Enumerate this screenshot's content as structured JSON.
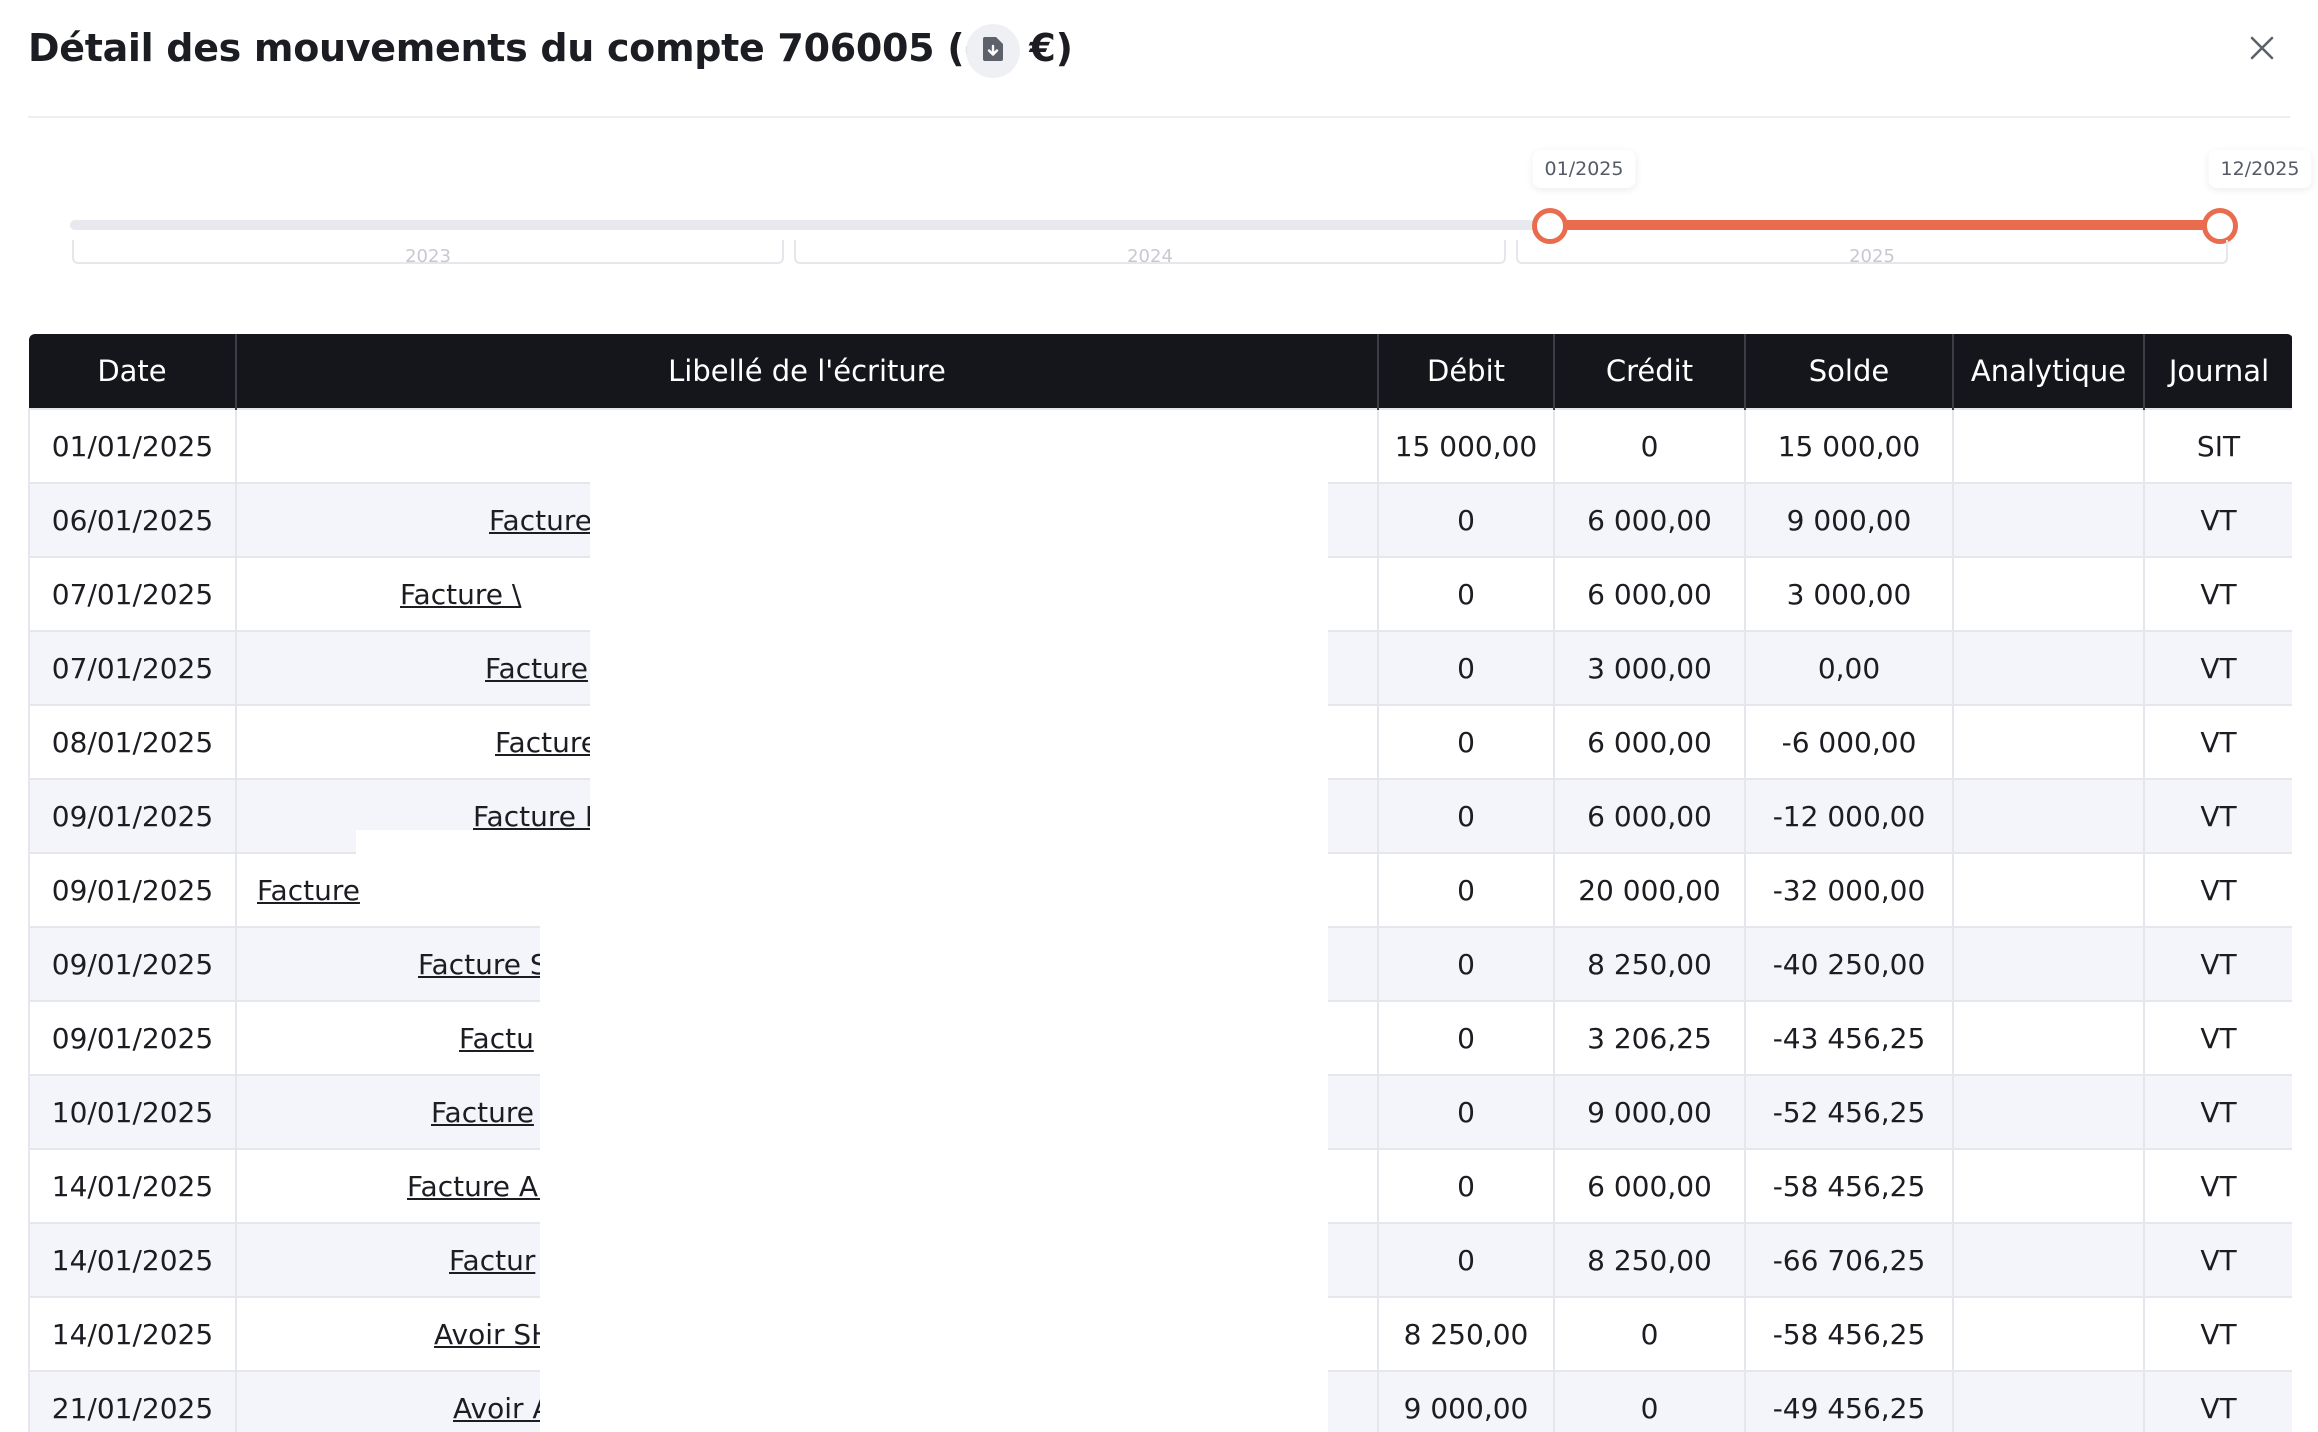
{
  "title": "Détail des mouvements du compte 706005 (en €)",
  "icons": {
    "export": "document-download-icon",
    "close": "close-icon"
  },
  "colors": {
    "accent": "#e96c4f",
    "header_bg": "#15161b"
  },
  "slider": {
    "start_label": "01/2025",
    "end_label": "12/2025",
    "years": [
      "2023",
      "2024",
      "2025"
    ]
  },
  "table": {
    "columns": [
      "Date",
      "Libellé de l'écriture",
      "Débit",
      "Crédit",
      "Solde",
      "Analytique",
      "Journal"
    ],
    "rows": [
      {
        "date": "01/01/2025",
        "libelle": "",
        "debit": "15 000,00",
        "credit": "0",
        "solde": "15 000,00",
        "analytique": "",
        "journal": "SIT"
      },
      {
        "date": "06/01/2025",
        "libelle": "Facture",
        "debit": "0",
        "credit": "6 000,00",
        "solde": "9 000,00",
        "analytique": "",
        "journal": "VT"
      },
      {
        "date": "07/01/2025",
        "libelle": "Facture \\",
        "debit": "0",
        "credit": "6 000,00",
        "solde": "3 000,00",
        "analytique": "",
        "journal": "VT"
      },
      {
        "date": "07/01/2025",
        "libelle": "Facture",
        "debit": "0",
        "credit": "3 000,00",
        "solde": "0,00",
        "analytique": "",
        "journal": "VT"
      },
      {
        "date": "08/01/2025",
        "libelle": "Facture",
        "debit": "0",
        "credit": "6 000,00",
        "solde": "-6 000,00",
        "analytique": "",
        "journal": "VT"
      },
      {
        "date": "09/01/2025",
        "libelle": "Facture F",
        "debit": "0",
        "credit": "6 000,00",
        "solde": "-12 000,00",
        "analytique": "",
        "journal": "VT"
      },
      {
        "date": "09/01/2025",
        "libelle": "Facture",
        "debit": "0",
        "credit": "20 000,00",
        "solde": "-32 000,00",
        "analytique": "",
        "journal": "VT"
      },
      {
        "date": "09/01/2025",
        "libelle": "Facture S",
        "debit": "0",
        "credit": "8 250,00",
        "solde": "-40 250,00",
        "analytique": "",
        "journal": "VT"
      },
      {
        "date": "09/01/2025",
        "libelle": "Factu",
        "debit": "0",
        "credit": "3 206,25",
        "solde": "-43 456,25",
        "analytique": "",
        "journal": "VT"
      },
      {
        "date": "10/01/2025",
        "libelle": "Facture",
        "debit": "0",
        "credit": "9 000,00",
        "solde": "-52 456,25",
        "analytique": "",
        "journal": "VT"
      },
      {
        "date": "14/01/2025",
        "libelle": "Facture Al",
        "debit": "0",
        "credit": "6 000,00",
        "solde": "-58 456,25",
        "analytique": "",
        "journal": "VT"
      },
      {
        "date": "14/01/2025",
        "libelle": "Factur",
        "debit": "0",
        "credit": "8 250,00",
        "solde": "-66 706,25",
        "analytique": "",
        "journal": "VT"
      },
      {
        "date": "14/01/2025",
        "libelle": "Avoir SH",
        "debit": "8 250,00",
        "credit": "0",
        "solde": "-58 456,25",
        "analytique": "",
        "journal": "VT"
      },
      {
        "date": "21/01/2025",
        "libelle": "Avoir A",
        "debit": "9 000,00",
        "credit": "0",
        "solde": "-49 456,25",
        "analytique": "",
        "journal": "VT"
      }
    ]
  }
}
